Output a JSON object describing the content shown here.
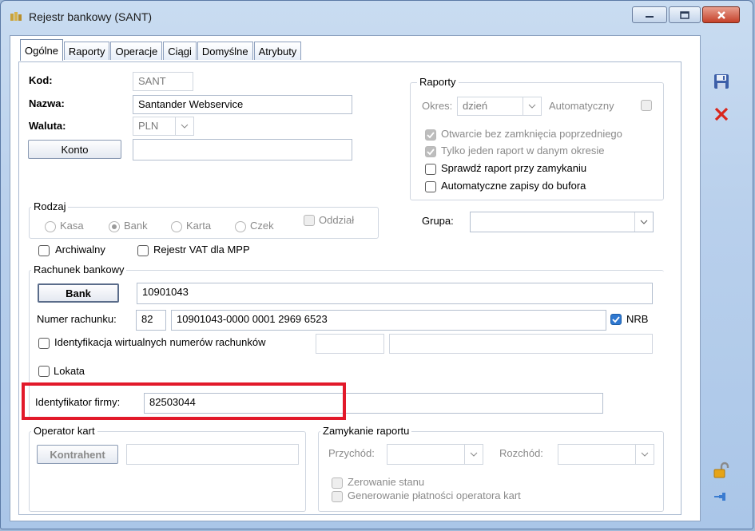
{
  "window": {
    "title": "Rejestr bankowy (SANT)"
  },
  "tabs": [
    "Ogólne",
    "Raporty",
    "Operacje",
    "Ciągi",
    "Domyślne",
    "Atrybuty"
  ],
  "general": {
    "kod_label": "Kod:",
    "kod_value": "SANT",
    "nazwa_label": "Nazwa:",
    "nazwa_value": "Santander Webservice",
    "waluta_label": "Waluta:",
    "waluta_value": "PLN",
    "konto_button": "Konto",
    "konto_value": ""
  },
  "raporty": {
    "title": "Raporty",
    "okres_label": "Okres:",
    "okres_value": "dzień",
    "automatyczny_label": "Automatyczny",
    "otwarcie_label": "Otwarcie bez zamknięcia poprzedniego",
    "jeden_label": "Tylko jeden raport w danym okresie",
    "sprawdz_label": "Sprawdź raport przy zamykaniu",
    "automatyczne_label": "Automatyczne zapisy do bufora"
  },
  "rodzaj": {
    "title": "Rodzaj",
    "options": [
      "Kasa",
      "Bank",
      "Karta",
      "Czek"
    ],
    "selected": "Bank",
    "oddzial_label": "Oddział"
  },
  "grupa": {
    "label": "Grupa:",
    "value": ""
  },
  "flags": {
    "archiwalny": "Archiwalny",
    "rejestr_vat": "Rejestr VAT dla MPP"
  },
  "rachunek": {
    "title": "Rachunek bankowy",
    "bank_button": "Bank",
    "bank_value": "10901043",
    "numer_label": "Numer rachunku:",
    "numer_prefix": "82",
    "numer_value": "10901043-0000 0001 2969 6523",
    "nrb_label": "NRB",
    "identyfikacja_label": "Identyfikacja wirtualnych numerów rachunków",
    "lokata_label": "Lokata",
    "id_firmy_label": "Identyfikator firmy:",
    "id_firmy_value": "82503044"
  },
  "operator": {
    "title": "Operator kart",
    "kontrahent_button": "Kontrahent",
    "kontrahent_value": ""
  },
  "zamykanie": {
    "title": "Zamykanie raportu",
    "przychod_label": "Przychód:",
    "rozchod_label": "Rozchód:",
    "zerowanie_label": "Zerowanie stanu",
    "generowanie_label": "Generowanie płatności operatora kart"
  },
  "colors": {
    "highlight": "#e2192a",
    "checked": "#2f78d0",
    "delete": "#d9261c"
  }
}
